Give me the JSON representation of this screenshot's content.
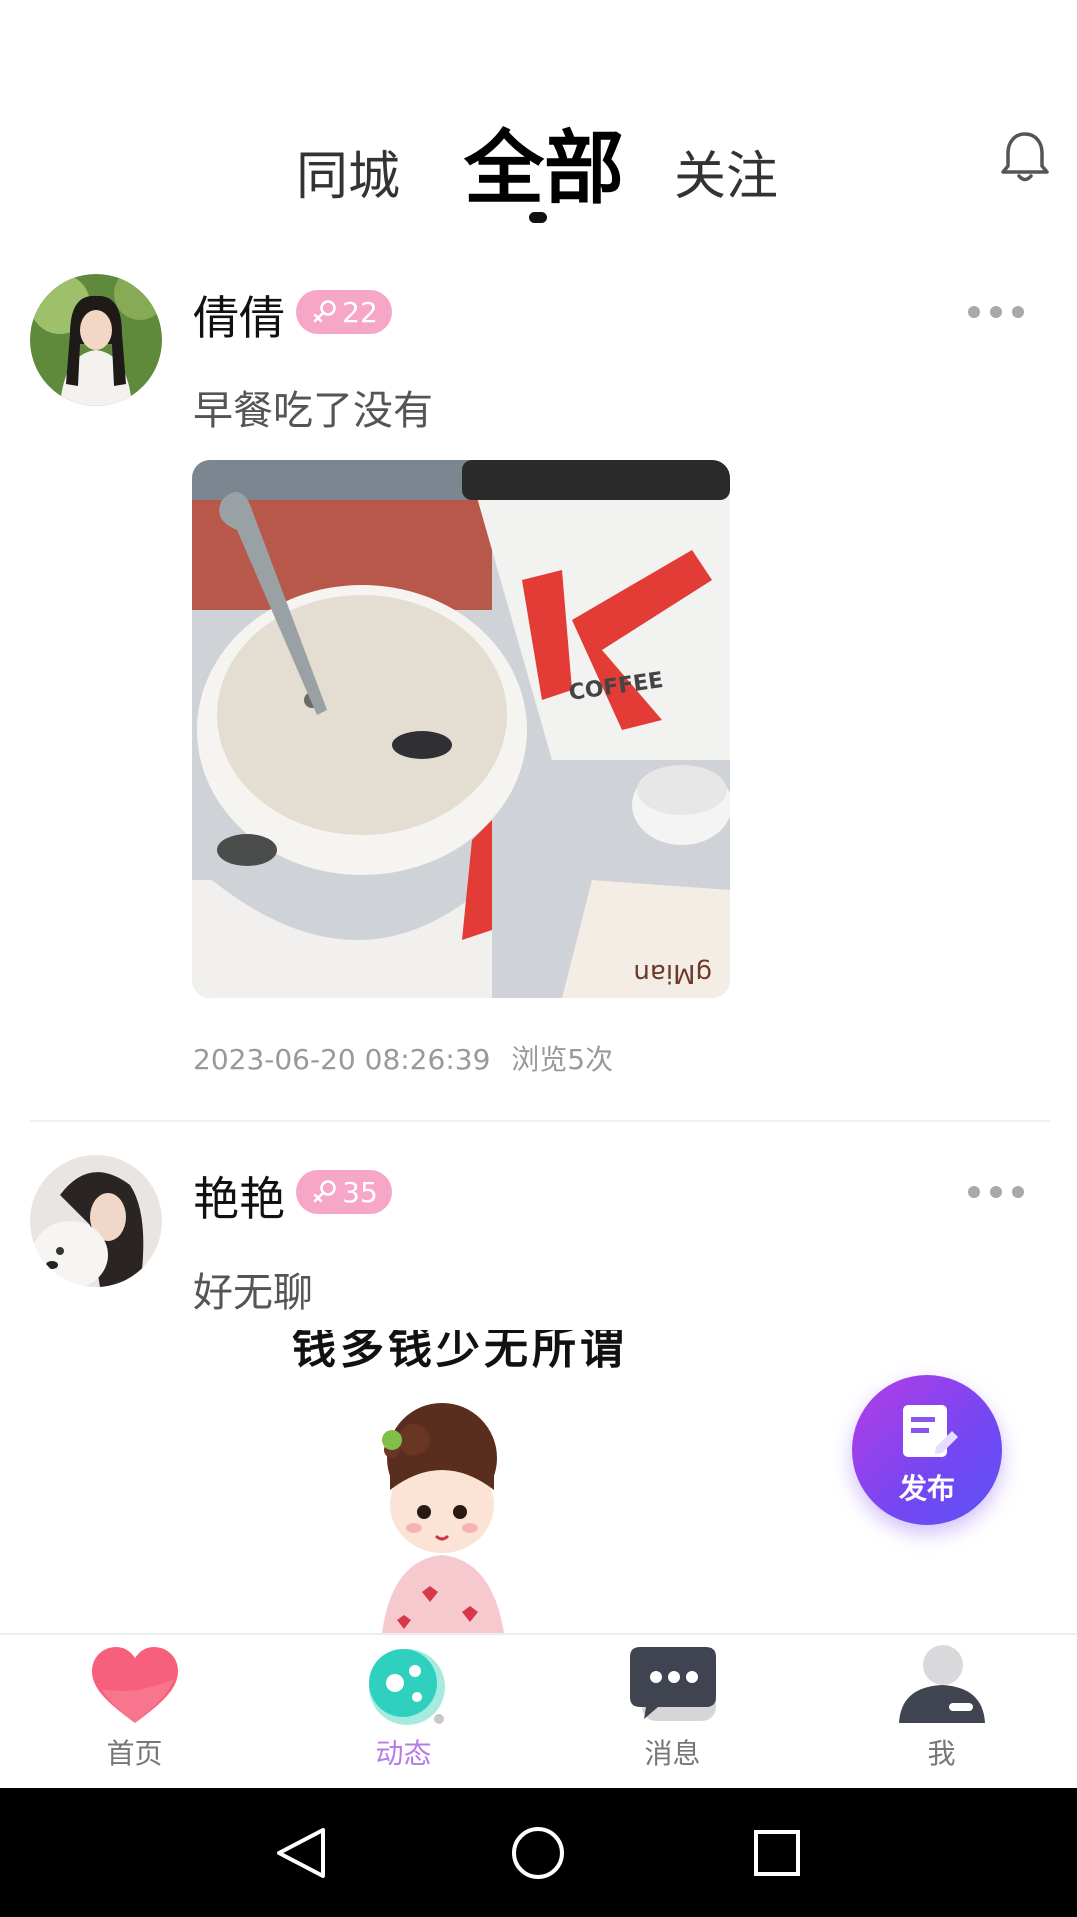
{
  "tabs": {
    "city": "同城",
    "all": "全部",
    "follow": "关注",
    "active": "all"
  },
  "posts": [
    {
      "username": "倩倩",
      "badge_age": "22",
      "badge_color": "#f6a6c6",
      "text": "早餐吃了没有",
      "timestamp": "2023-06-20 08:26:39",
      "views": "浏览5次",
      "image_text": "COFFEE",
      "image_text_2": "gMian"
    },
    {
      "username": "艳艳",
      "badge_age": "35",
      "badge_color": "#f6a6c6",
      "text": "好无聊",
      "image_caption": "钱多钱少无所谓"
    }
  ],
  "fab": {
    "label": "发布"
  },
  "bottom_nav": [
    {
      "label": "首页",
      "icon": "heart-icon"
    },
    {
      "label": "动态",
      "icon": "bubble-planet-icon"
    },
    {
      "label": "消息",
      "icon": "chat-icon"
    },
    {
      "label": "我",
      "icon": "user-icon"
    }
  ],
  "colors": {
    "accent_purple": "#b77de6",
    "badge_pink": "#f6a6c6",
    "fab_gradient_start": "#b53ce6",
    "fab_gradient_end": "#5a52f5"
  }
}
